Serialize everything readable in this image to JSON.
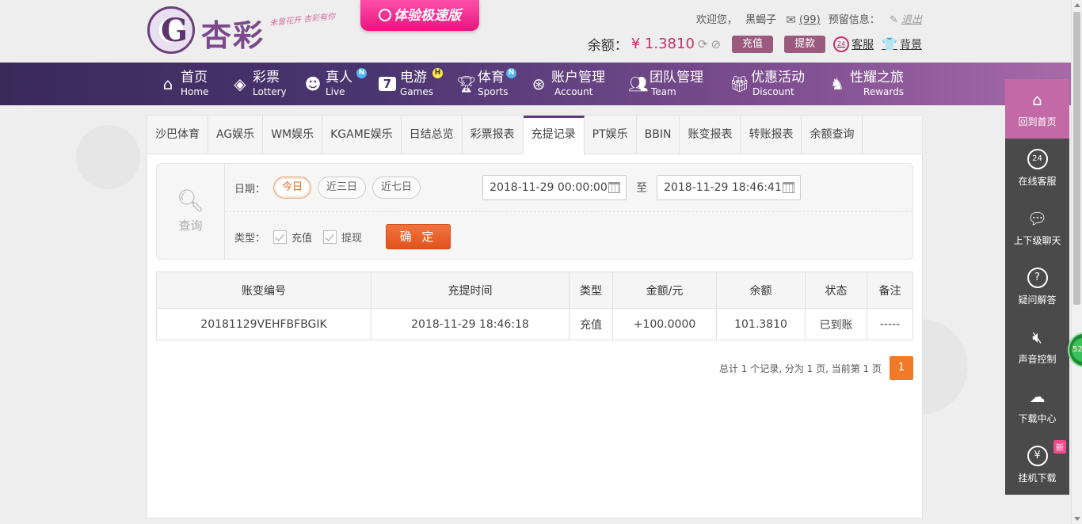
{
  "header": {
    "logo_name": "杏彩",
    "logo_slogan": "未曾花开 杏彩有你",
    "promo": "体验极速版",
    "welcome": "欢迎您，",
    "username": "黑蝎子",
    "mail_count": "(99)",
    "reserve_info": "预留信息：",
    "logout": "退出",
    "balance_label": "余额：",
    "balance": "¥ 1.3810",
    "deposit": "充值",
    "withdraw": "提款",
    "support": "客服",
    "support_badge": "24",
    "background": "背景"
  },
  "nav": [
    {
      "zh": "首页",
      "en": "Home",
      "icon": "home-icon"
    },
    {
      "zh": "彩票",
      "en": "Lottery",
      "icon": "lottery-icon"
    },
    {
      "zh": "真人",
      "en": "Live",
      "icon": "live-icon",
      "badge": "N"
    },
    {
      "zh": "电游",
      "en": "Games",
      "icon": "games-icon",
      "badge": "H"
    },
    {
      "zh": "体育",
      "en": "Sports",
      "icon": "trophy-icon",
      "badge": "N"
    },
    {
      "zh": "账户管理",
      "en": "Account",
      "icon": "account-icon"
    },
    {
      "zh": "团队管理",
      "en": "Team",
      "icon": "team-icon"
    },
    {
      "zh": "优惠活动",
      "en": "Discount",
      "icon": "gift-icon"
    },
    {
      "zh": "性耀之旅",
      "en": "Rewards",
      "icon": "rewards-icon"
    }
  ],
  "tabs": [
    "沙巴体育",
    "AG娱乐",
    "WM娱乐",
    "KGAME娱乐",
    "日结总览",
    "彩票报表",
    "充提记录",
    "PT娱乐",
    "BBIN",
    "账变报表",
    "转账报表",
    "余额查询"
  ],
  "active_tab": "充提记录",
  "query": {
    "label": "查询",
    "date_label": "日期：",
    "today": "今日",
    "three_days": "近三日",
    "seven_days": "近七日",
    "start": "2018-11-29 00:00:00",
    "to": "至",
    "end": "2018-11-29 18:46:41",
    "type_label": "类型：",
    "type_deposit": "充值",
    "type_withdraw": "提现",
    "confirm": "确 定"
  },
  "table": {
    "headers": [
      "账变编号",
      "充提时间",
      "类型",
      "金额/元",
      "余额",
      "状态",
      "备注"
    ],
    "rows": [
      [
        "20181129VEHFBFBGIK",
        "2018-11-29 18:46:18",
        "充值",
        "+100.0000",
        "101.3810",
        "已到账",
        "-----"
      ]
    ]
  },
  "pager": {
    "info": "总计 1 个记录, 分为 1 页, 当前第 1 页",
    "page": "1"
  },
  "sidebar": [
    {
      "label": "回到首页",
      "icon": "home-icon"
    },
    {
      "label": "在线客服",
      "icon": "headset-icon",
      "glyph": "24"
    },
    {
      "label": "上下级聊天",
      "icon": "chat-icon"
    },
    {
      "label": "疑问解答",
      "icon": "question-icon",
      "glyph": "?"
    },
    {
      "label": "声音控制",
      "icon": "sound-icon"
    },
    {
      "label": "下载中心",
      "icon": "download-icon"
    },
    {
      "label": "挂机下载",
      "icon": "money-bag-icon",
      "glyph": "¥",
      "badge": "新"
    }
  ],
  "float_ball": "52",
  "colors": {
    "accent": "#5e3a7a",
    "brand_pink": "#c6306a",
    "confirm": "#e0531e",
    "ok": "#2aa02a"
  }
}
